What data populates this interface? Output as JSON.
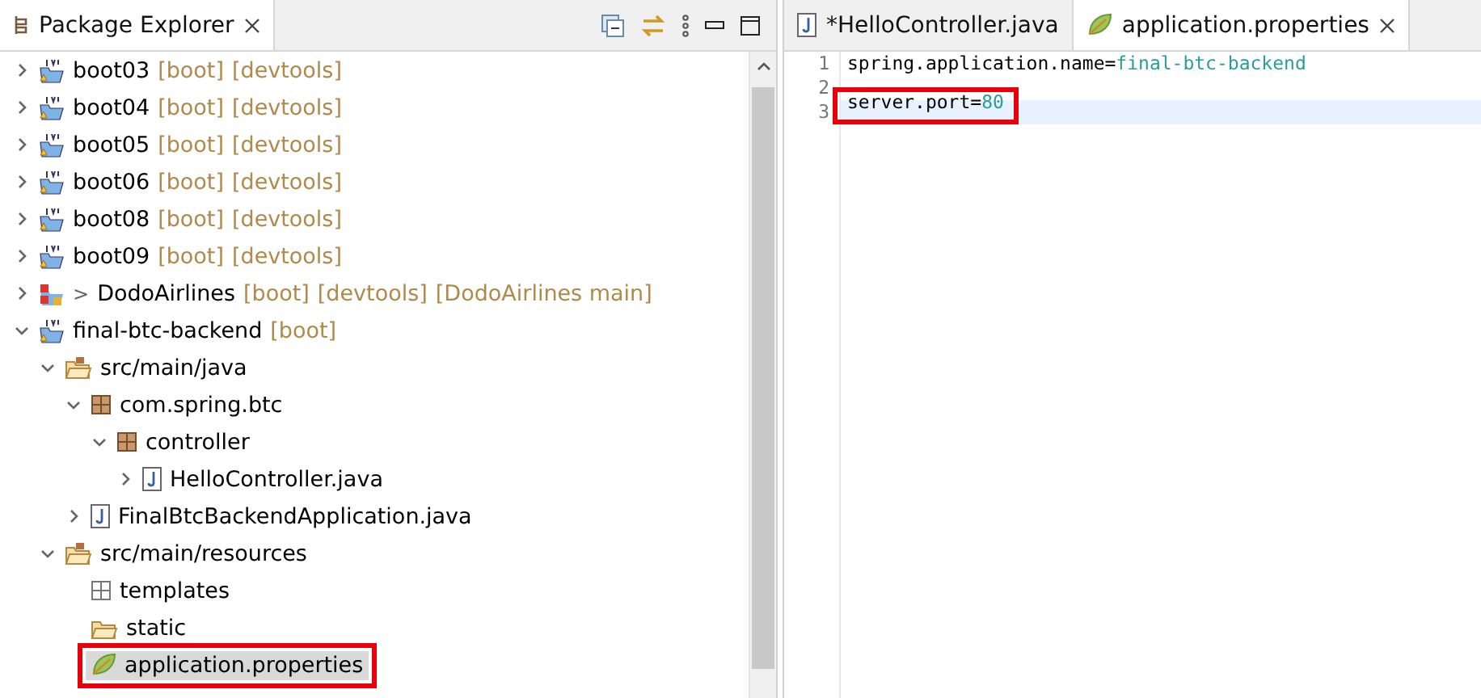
{
  "explorer": {
    "title": "Package Explorer",
    "tree": [
      {
        "kind": "project",
        "name": "boot03",
        "decorations": [
          "[boot]",
          "[devtools]"
        ],
        "expanded": false,
        "selected": false
      },
      {
        "kind": "project",
        "name": "boot04",
        "decorations": [
          "[boot]",
          "[devtools]"
        ],
        "expanded": false,
        "selected": false
      },
      {
        "kind": "project",
        "name": "boot05",
        "decorations": [
          "[boot]",
          "[devtools]"
        ],
        "expanded": false,
        "selected": false
      },
      {
        "kind": "project",
        "name": "boot06",
        "decorations": [
          "[boot]",
          "[devtools]"
        ],
        "expanded": false,
        "selected": false
      },
      {
        "kind": "project",
        "name": "boot08",
        "decorations": [
          "[boot]",
          "[devtools]"
        ],
        "expanded": false,
        "selected": false
      },
      {
        "kind": "project",
        "name": "boot09",
        "decorations": [
          "[boot]",
          "[devtools]"
        ],
        "expanded": false,
        "selected": false
      },
      {
        "kind": "git-project",
        "prefix": ">",
        "name": "DodoAirlines",
        "decorations": [
          "[boot]",
          "[devtools]",
          "[DodoAirlines main]"
        ],
        "expanded": false,
        "selected": false
      },
      {
        "kind": "project",
        "name": "final-btc-backend",
        "decorations": [
          "[boot]"
        ],
        "expanded": true,
        "selected": false,
        "children": [
          {
            "kind": "source-folder",
            "name": "src/main/java",
            "expanded": true,
            "selected": false,
            "children": [
              {
                "kind": "package",
                "name": "com.spring.btc",
                "expanded": true,
                "selected": false,
                "children": [
                  {
                    "kind": "package",
                    "name": "controller",
                    "expanded": true,
                    "selected": false,
                    "children": [
                      {
                        "kind": "java-file",
                        "name": "HelloController.java",
                        "expanded": false,
                        "selected": false
                      }
                    ]
                  }
                ]
              },
              {
                "kind": "java-file",
                "name": "FinalBtcBackendApplication.java",
                "expanded": false,
                "selected": false
              }
            ]
          },
          {
            "kind": "source-folder",
            "name": "src/main/resources",
            "expanded": true,
            "selected": false,
            "children": [
              {
                "kind": "empty-package",
                "name": "templates",
                "selected": false
              },
              {
                "kind": "folder",
                "name": "static",
                "selected": false
              },
              {
                "kind": "properties-file",
                "name": "application.properties",
                "selected": true,
                "highlighted": true
              }
            ]
          }
        ]
      }
    ]
  },
  "editor": {
    "tabs": [
      {
        "label": "*HelloController.java",
        "kind": "java-file",
        "selected": false
      },
      {
        "label": "application.properties",
        "kind": "properties-file",
        "selected": true
      }
    ],
    "lines": [
      {
        "number": "1",
        "key": "spring.application.name=",
        "value": "final-btc-backend",
        "current": false
      },
      {
        "number": "2",
        "current": false
      },
      {
        "number": "3",
        "key": "server.port=",
        "value": "80",
        "current": true,
        "highlighted": true
      }
    ]
  }
}
